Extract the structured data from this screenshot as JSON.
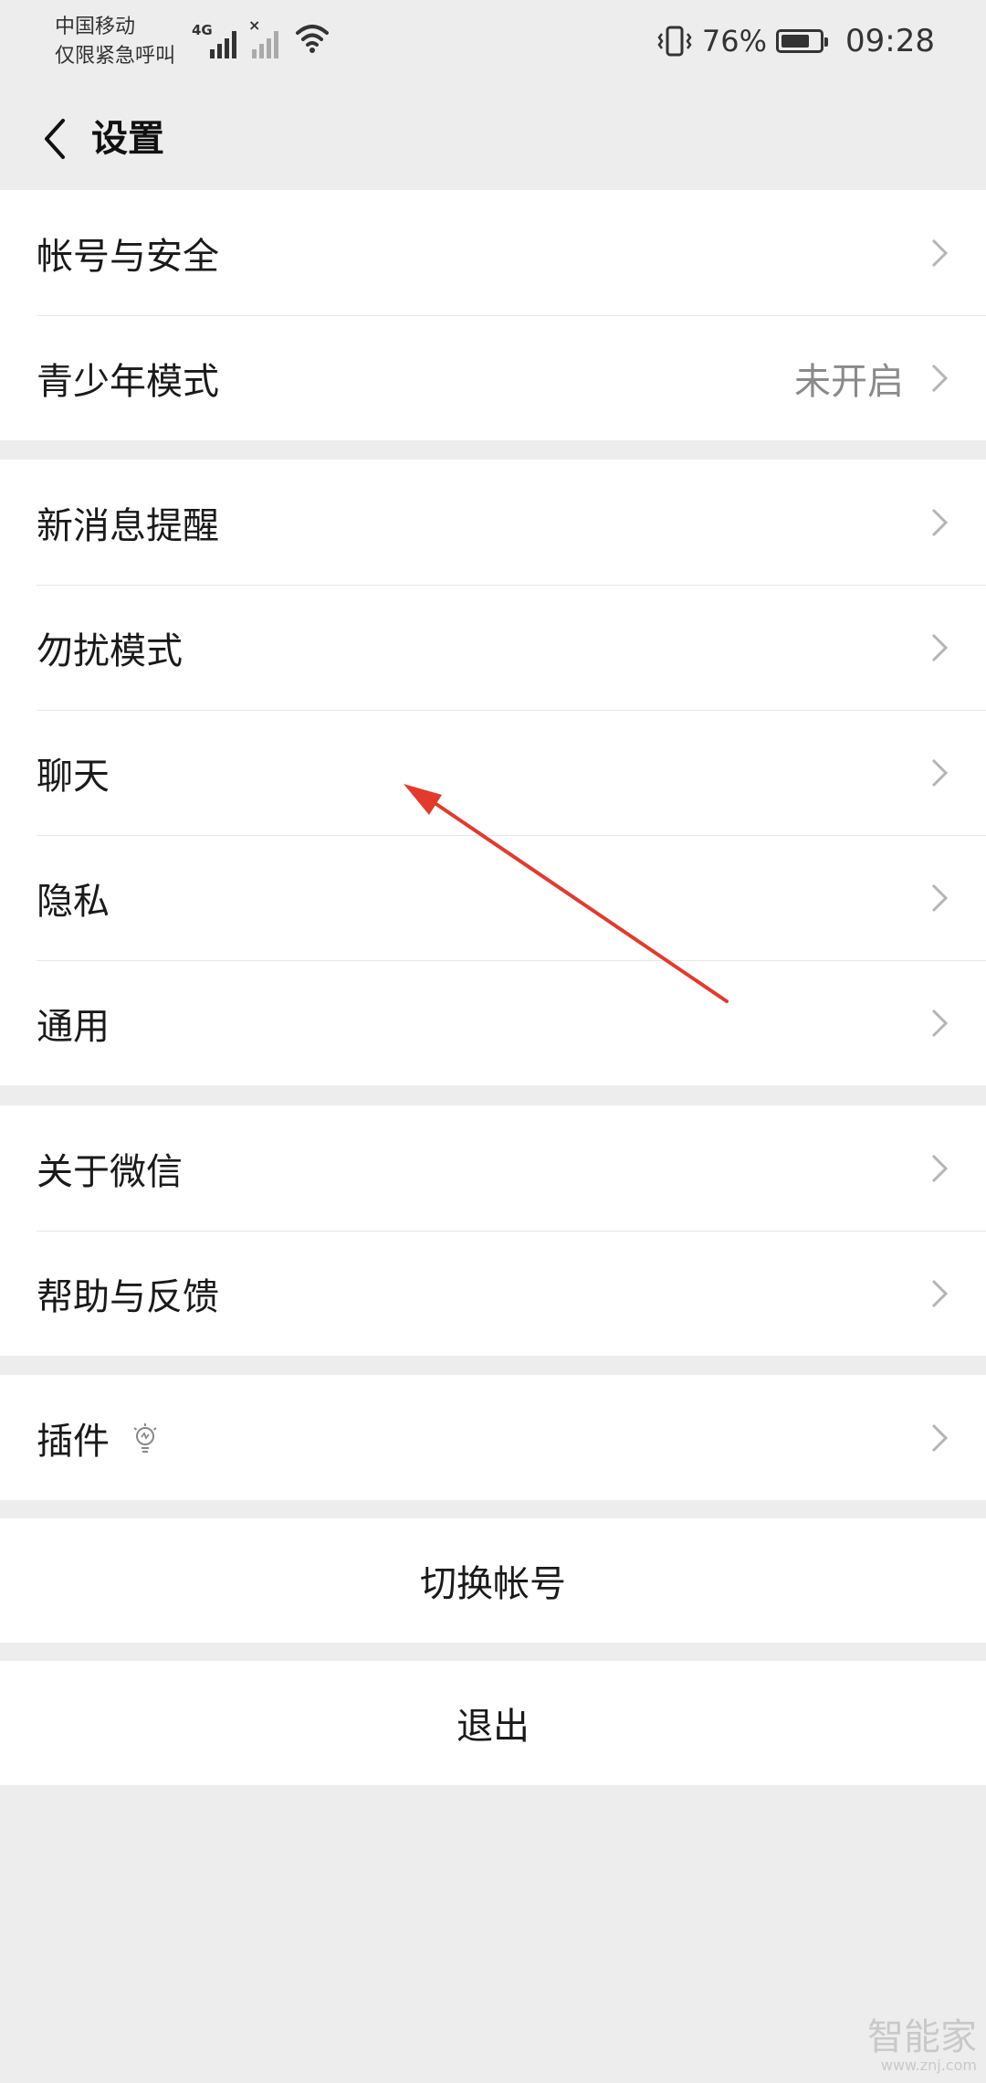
{
  "status_bar": {
    "carrier_line1": "中国移动",
    "carrier_line2": "仅限紧急呼叫",
    "network_type": "4G",
    "battery_text": "76%",
    "battery_level": 0.76,
    "time": "09:28",
    "icons": [
      "signal-icon",
      "no-signal-icon",
      "wifi-icon",
      "vibrate-icon",
      "battery-icon"
    ]
  },
  "nav": {
    "title": "设置",
    "back_icon": "chevron-left-icon"
  },
  "groups": [
    {
      "items": [
        {
          "label": "帐号与安全"
        },
        {
          "label": "青少年模式",
          "value": "未开启"
        }
      ]
    },
    {
      "items": [
        {
          "label": "新消息提醒"
        },
        {
          "label": "勿扰模式"
        },
        {
          "label": "聊天"
        },
        {
          "label": "隐私"
        },
        {
          "label": "通用"
        }
      ]
    },
    {
      "items": [
        {
          "label": "关于微信"
        },
        {
          "label": "帮助与反馈"
        }
      ]
    },
    {
      "items": [
        {
          "label": "插件",
          "icon": "lightbulb-icon"
        }
      ]
    }
  ],
  "switch_account": {
    "label": "切换帐号"
  },
  "logout": {
    "label": "退出"
  },
  "watermark": {
    "main": "智能家",
    "sub": "www.znj.com"
  },
  "colors": {
    "background": "#ededed",
    "row": "#ffffff",
    "annotation_arrow": "#e23b2e",
    "secondary_text": "#8a8a8a"
  }
}
